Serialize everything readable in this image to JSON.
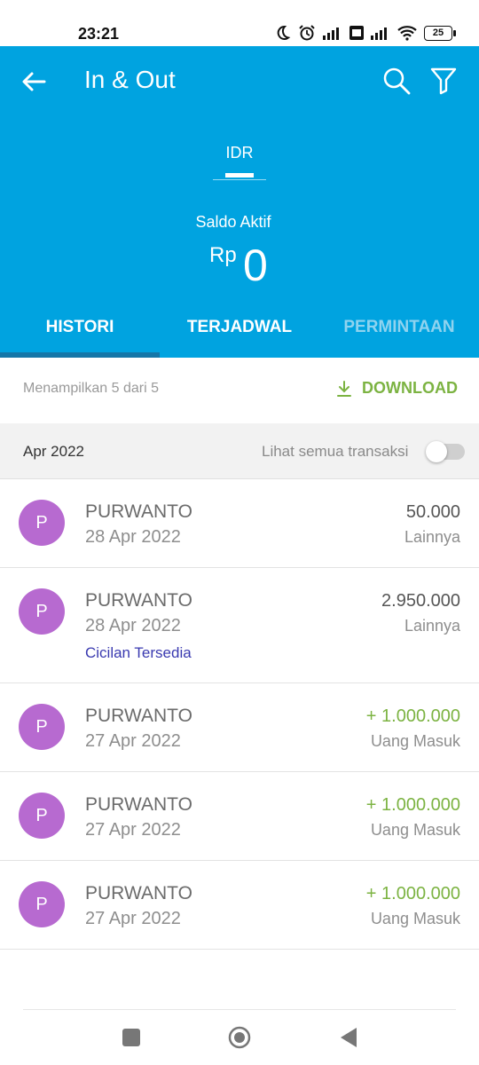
{
  "status_bar": {
    "time": "23:21",
    "battery": "25"
  },
  "header": {
    "title": "In & Out",
    "currency_tab": "IDR",
    "balance_label": "Saldo Aktif",
    "balance_currency": "Rp",
    "balance_value": "0",
    "color": "#00a3e0"
  },
  "tabs": [
    {
      "label": "HISTORI",
      "active": true
    },
    {
      "label": "TERJADWAL",
      "active": false
    },
    {
      "label": "PERMINTAAN",
      "active": false
    }
  ],
  "summary": {
    "text": "Menampilkan 5 dari 5",
    "download_label": "DOWNLOAD"
  },
  "group": {
    "month": "Apr 2022",
    "show_all_label": "Lihat semua transaksi",
    "show_all_enabled": false
  },
  "transactions": [
    {
      "initial": "P",
      "name": "PURWANTO",
      "date": "28 Apr 2022",
      "amount": "50.000",
      "category": "Lainnya",
      "installment": ""
    },
    {
      "initial": "P",
      "name": "PURWANTO",
      "date": "28 Apr 2022",
      "amount": "2.950.000",
      "category": "Lainnya",
      "installment": "Cicilan Tersedia"
    },
    {
      "initial": "P",
      "name": "PURWANTO",
      "date": "27 Apr 2022",
      "amount": "+ 1.000.000",
      "category": "Uang Masuk",
      "installment": ""
    },
    {
      "initial": "P",
      "name": "PURWANTO",
      "date": "27 Apr 2022",
      "amount": "+ 1.000.000",
      "category": "Uang Masuk",
      "installment": ""
    },
    {
      "initial": "P",
      "name": "PURWANTO",
      "date": "27 Apr 2022",
      "amount": "+ 1.000.000",
      "category": "Uang Masuk",
      "installment": ""
    }
  ],
  "colors": {
    "accent": "#00a3e0",
    "positive": "#7cb342",
    "avatar": "#b76ad0",
    "installment": "#3a3ab0"
  }
}
